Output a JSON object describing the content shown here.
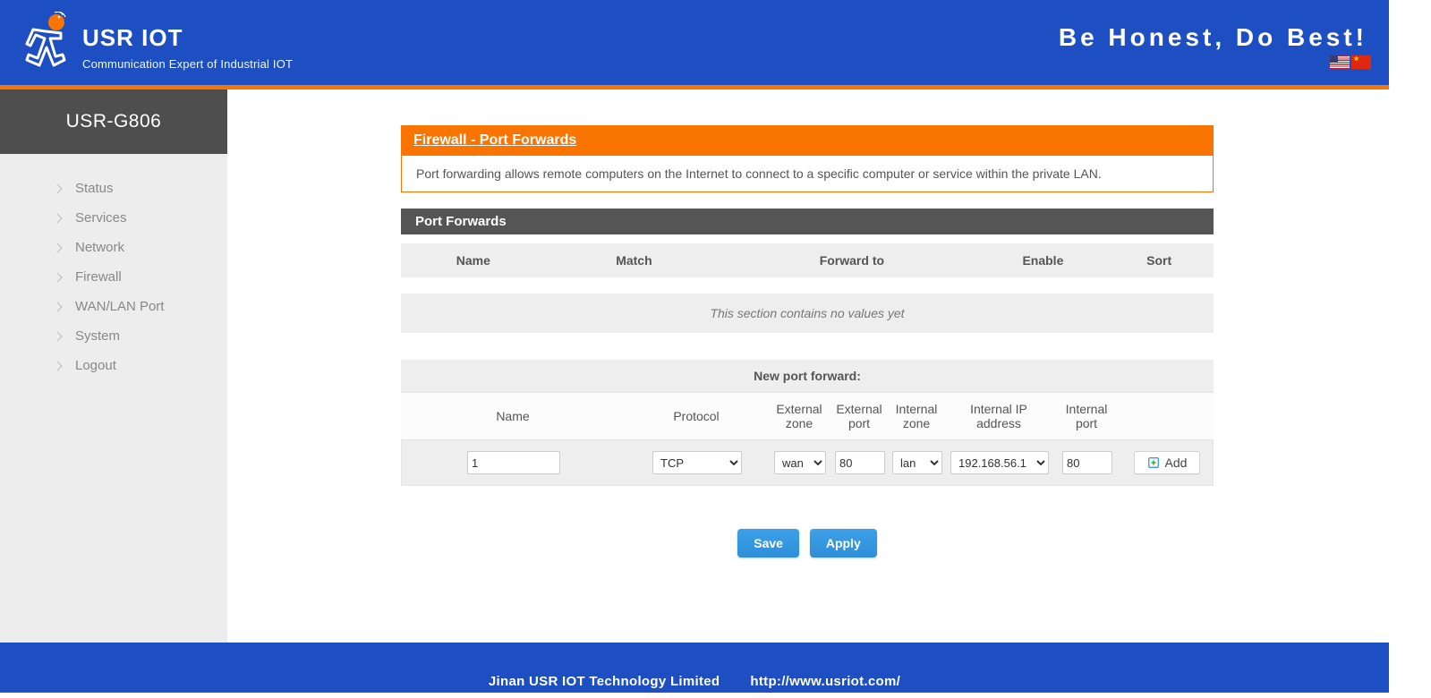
{
  "header": {
    "brand_title": "USR IOT",
    "brand_sub": "Communication Expert of Industrial IOT",
    "slogan": "Be Honest, Do Best!"
  },
  "device_name": "USR-G806",
  "sidebar": {
    "items": [
      {
        "label": "Status"
      },
      {
        "label": "Services"
      },
      {
        "label": "Network"
      },
      {
        "label": "Firewall"
      },
      {
        "label": "WAN/LAN Port"
      },
      {
        "label": "System"
      },
      {
        "label": "Logout"
      }
    ]
  },
  "panel": {
    "title": "Firewall - Port Forwards",
    "desc": "Port forwarding allows remote computers on the Internet to connect to a specific computer or service within the private LAN."
  },
  "section_title": "Port Forwards",
  "table": {
    "headers": {
      "name": "Name",
      "match": "Match",
      "forward_to": "Forward to",
      "enable": "Enable",
      "sort": "Sort"
    },
    "empty_text": "This section contains no values yet"
  },
  "new_forward": {
    "title": "New port forward:",
    "headers": {
      "name": "Name",
      "protocol": "Protocol",
      "ext_zone": "External zone",
      "ext_port": "External port",
      "int_zone": "Internal zone",
      "int_ip": "Internal IP address",
      "int_port": "Internal port"
    },
    "values": {
      "name": "1",
      "protocol": "TCP",
      "ext_zone": "wan",
      "ext_port": "80",
      "int_zone": "lan",
      "int_ip": "192.168.56.1",
      "int_port": "80"
    },
    "add_label": "Add"
  },
  "actions": {
    "save": "Save",
    "apply": "Apply"
  },
  "footer": {
    "company": "Jinan USR IOT Technology Limited",
    "url": "http://www.usriot.com/"
  }
}
